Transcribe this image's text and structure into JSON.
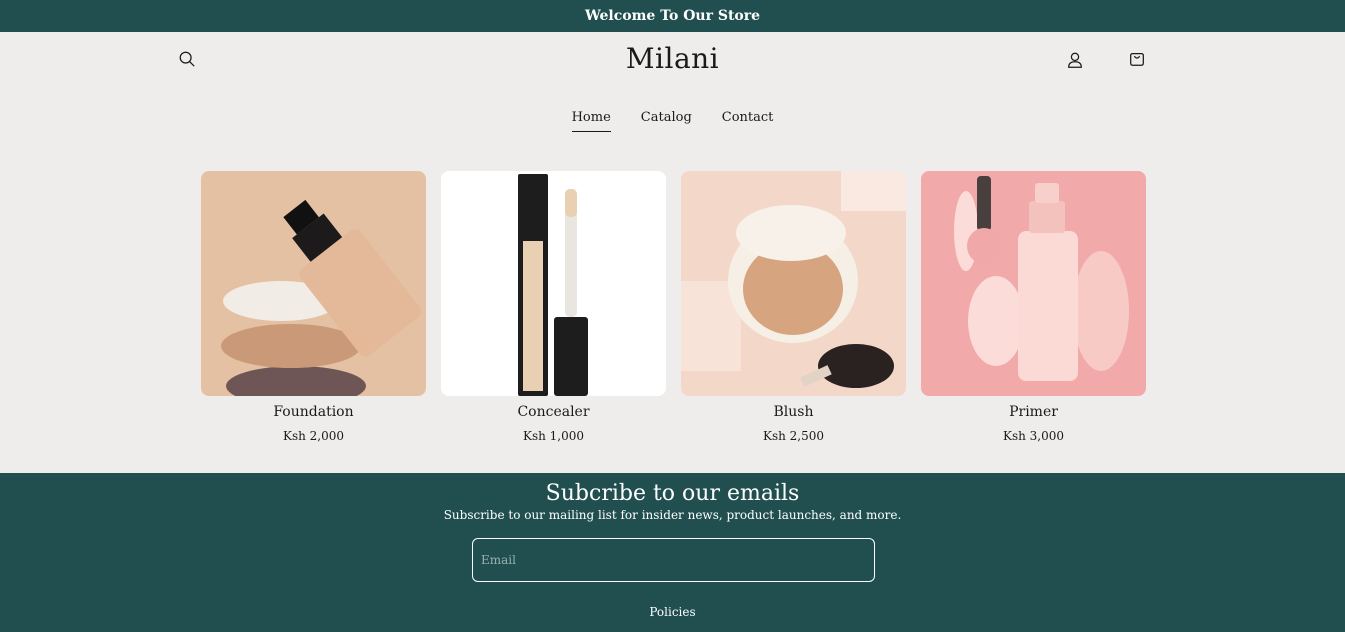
{
  "announcement": {
    "text": "Welcome To Our Store"
  },
  "header": {
    "logo": "Milani",
    "icons": [
      "search-icon",
      "account-icon",
      "cart-icon"
    ]
  },
  "nav": {
    "items": [
      {
        "label": "Home",
        "active": true
      },
      {
        "label": "Catalog",
        "active": false
      },
      {
        "label": "Contact",
        "active": false
      }
    ]
  },
  "products": [
    {
      "title": "Foundation",
      "price": "Ksh 2,000"
    },
    {
      "title": "Concealer",
      "price": "Ksh 1,000"
    },
    {
      "title": "Blush",
      "price": "Ksh 2,500"
    },
    {
      "title": "Primer",
      "price": "Ksh 3,000"
    }
  ],
  "footer": {
    "heading": "Subcribe to our emails",
    "subtext": "Subscribe to our mailing list for insider news, product launches, and more.",
    "email_placeholder": "Email",
    "policies": "Policies"
  },
  "colors": {
    "brand": "#214f50",
    "background": "#efedeb"
  }
}
